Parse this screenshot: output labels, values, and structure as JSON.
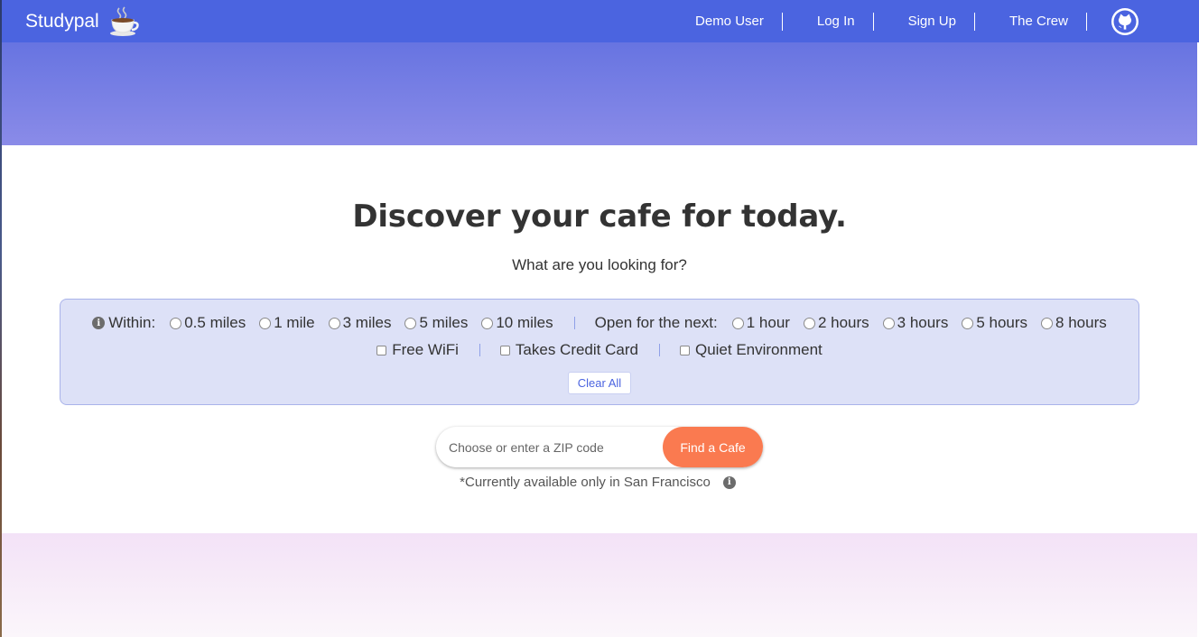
{
  "navbar": {
    "brand": "Studypal",
    "links": [
      "Demo User",
      "Log In",
      "Sign Up",
      "The Crew"
    ],
    "icons": {
      "brand": "coffee-cup-icon",
      "github": "github-icon"
    }
  },
  "main": {
    "headline": "Discover your cafe for today.",
    "subhead": "What are you looking for?"
  },
  "filters": {
    "within_label": "Within:",
    "within_options": [
      "0.5 miles",
      "1 mile",
      "3 miles",
      "5 miles",
      "10 miles"
    ],
    "open_label": "Open for the next:",
    "open_options": [
      "1 hour",
      "2 hours",
      "3 hours",
      "5 hours",
      "8 hours"
    ],
    "amenities": [
      "Free WiFi",
      "Takes Credit Card",
      "Quiet Environment"
    ],
    "clear_label": "Clear All"
  },
  "search": {
    "placeholder": "Choose or enter a ZIP code",
    "button": "Find a Cafe",
    "note": "*Currently available only in San Francisco"
  },
  "colors": {
    "navbar": "#4b64e0",
    "accent": "#fa7a50",
    "filter_bg": "#dde1f7"
  }
}
